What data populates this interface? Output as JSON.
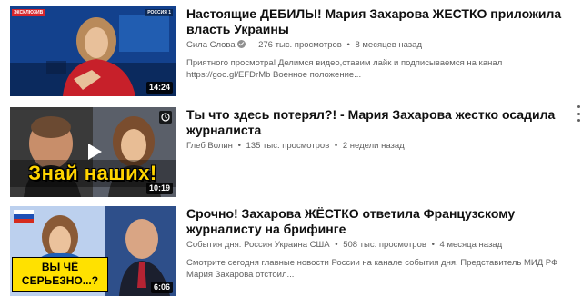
{
  "videos": [
    {
      "title": "Настоящие ДЕБИЛЫ! Мария Захарова ЖЕСТКО приложила власть Украины",
      "channel": "Сила Слова",
      "verified": true,
      "views": "276 тыс. просмотров",
      "age": "8 месяцев назад",
      "duration": "14:24",
      "description": "Приятного просмотра! Делимся видео,ставим лайк и подписываемся на канал https://goo.gl/EFDrMb Военное положение...",
      "thumb_badge": "ЭКСКЛЮЗИВ",
      "thumb_logo": "РОССИЯ 1"
    },
    {
      "title": "Ты что здесь потерял?! - Мария Захарова жестко осадила журналиста",
      "channel": "Глеб Волин",
      "verified": false,
      "views": "135 тыс. просмотров",
      "age": "2 недели назад",
      "duration": "10:19",
      "description": "",
      "thumb_caption": "Знай наших!"
    },
    {
      "title": "Срочно! Захарова ЖЁСТКО ответила Французскому журналисту на брифинге",
      "channel": "События дня: Россия Украина США",
      "verified": false,
      "views": "508 тыс. просмотров",
      "age": "4 месяца назад",
      "duration": "6:06",
      "description": "Смотрите сегодня главные новости России на канале события дня. Представитель МИД РФ Мария Захарова отстоил...",
      "thumb_caption_line1": "ВЫ ЧЁ",
      "thumb_caption_line2": "СЕРЬЕЗНО...?"
    }
  ],
  "icons": {
    "kebab": "more-vert-icon",
    "clock": "watch-later-icon",
    "play": "play-icon",
    "verified": "verified-check-icon"
  }
}
